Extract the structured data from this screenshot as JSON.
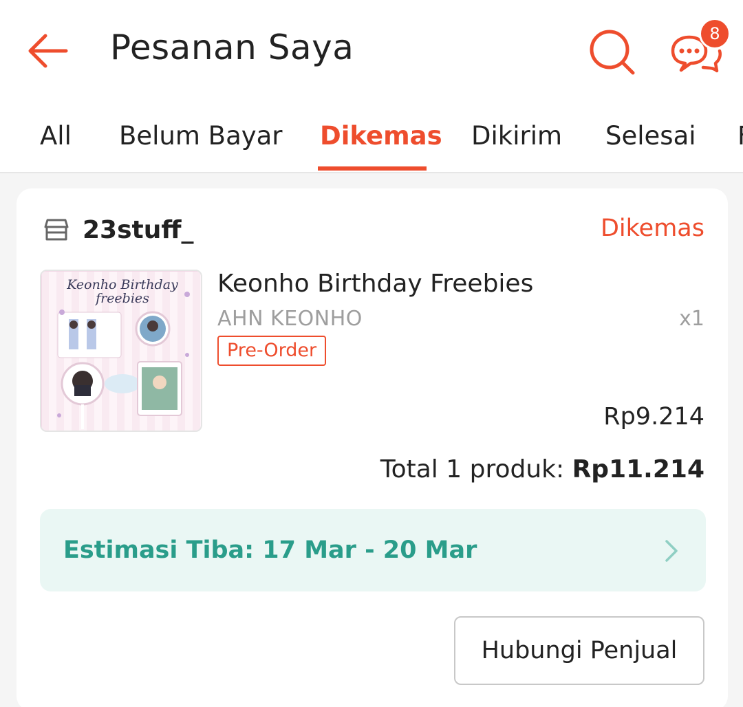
{
  "header": {
    "title": "Pesanan Saya",
    "back_icon": "arrow-left-icon",
    "search_icon": "search-icon",
    "chat_icon": "chat-bubbles-icon",
    "chat_badge_count": "8",
    "accent_color": "#ee4d2d"
  },
  "tabs": [
    {
      "label": "All"
    },
    {
      "label": "Belum Bayar"
    },
    {
      "label": "Dikemas",
      "active": true
    },
    {
      "label": "Dikirim"
    },
    {
      "label": "Selesai"
    }
  ],
  "order": {
    "shop_icon": "store-icon",
    "shop_name": "23stuff_",
    "status": "Dikemas",
    "product": {
      "thumbnail_title_line1": "Keonho Birthday",
      "thumbnail_title_line2": "freebies",
      "name": "Keonho Birthday Freebies",
      "variant": "AHN KEONHO",
      "quantity": "x1",
      "tag": "Pre-Order",
      "price": "Rp9.214"
    },
    "total_label": "Total 1 produk: ",
    "total_amount": "Rp11.214",
    "eta": {
      "text": "Estimasi Tiba: 17 Mar - 20 Mar",
      "color": "#2a9d8a",
      "chevron_icon": "chevron-right-icon"
    },
    "contact_button": "Hubungi Penjual"
  }
}
